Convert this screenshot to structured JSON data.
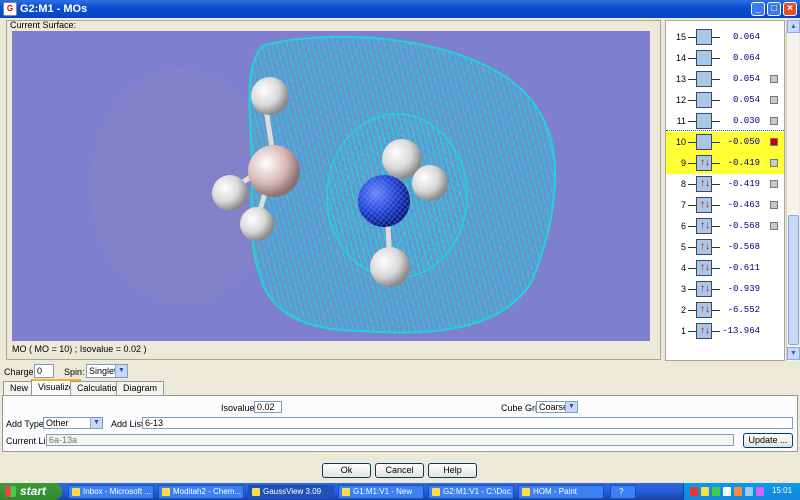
{
  "window": {
    "title": "G2:M1 - MOs",
    "minimize": "_",
    "maximize": "□",
    "close": "×"
  },
  "surface": {
    "label": "Current Surface:",
    "caption": "MO  ( MO = 10) ; Isovalue = 0.02 )"
  },
  "mo_levels": [
    {
      "index": "15",
      "energy": "0.064",
      "occupied": false,
      "selectable": false
    },
    {
      "index": "14",
      "energy": "0.064",
      "occupied": false,
      "selectable": false
    },
    {
      "index": "13",
      "energy": "0.054",
      "occupied": false,
      "selectable": true
    },
    {
      "index": "12",
      "energy": "0.054",
      "occupied": false,
      "selectable": true
    },
    {
      "index": "11",
      "energy": "0.030",
      "occupied": false,
      "selectable": true
    },
    {
      "index": "10",
      "energy": "-0.050",
      "occupied": false,
      "selectable": true,
      "highlight": true,
      "current": true
    },
    {
      "index": "9",
      "energy": "-0.419",
      "occupied": true,
      "selectable": true,
      "highlight": true
    },
    {
      "index": "8",
      "energy": "-0.419",
      "occupied": true,
      "selectable": true
    },
    {
      "index": "7",
      "energy": "-0.463",
      "occupied": true,
      "selectable": true
    },
    {
      "index": "6",
      "energy": "-0.568",
      "occupied": true,
      "selectable": true
    },
    {
      "index": "5",
      "energy": "-0.568",
      "occupied": true,
      "selectable": false
    },
    {
      "index": "4",
      "energy": "-0.611",
      "occupied": true,
      "selectable": false
    },
    {
      "index": "3",
      "energy": "-0.939",
      "occupied": true,
      "selectable": false
    },
    {
      "index": "2",
      "energy": "-6.552",
      "occupied": true,
      "selectable": false
    },
    {
      "index": "1",
      "energy": "-13.964",
      "occupied": true,
      "selectable": false
    }
  ],
  "colors": {
    "highlight": "#ffff33",
    "current_marker": "#cc0000",
    "viewport_bg": "#7f7fd0",
    "isosurface": "#22d4d4"
  },
  "controls": {
    "charge_label": "Charge:",
    "charge_value": "0",
    "spin_label": "Spin:",
    "spin_value": "Singlet"
  },
  "tabs": [
    "New",
    "Visualize",
    "Calculation",
    "Diagram"
  ],
  "active_tab": "Visualize",
  "visualize": {
    "isovalue_label": "Isovalue:",
    "isovalue": "0.02",
    "cube_grid_label": "Cube Grid:",
    "cube_grid": "Coarse",
    "add_type_label": "Add Type:",
    "add_type": "Other",
    "add_list_label": "Add List:",
    "add_list": "6-13",
    "current_list_label": "Current List:",
    "current_list": "6a-13a",
    "update_button": "Update ..."
  },
  "buttons": {
    "ok": "Ok",
    "cancel": "Cancel",
    "help": "Help"
  },
  "taskbar": {
    "start": "start",
    "tasks": [
      "Inbox - Microsoft ...",
      "Moditah2 - Chem...",
      "GaussView 3.09",
      "G1:M1:V1 - New",
      "G2:M1:V1 - C:\\Doc...",
      "HOM - Paint"
    ],
    "active_task": "GaussView 3.09",
    "clock": "15:01"
  }
}
